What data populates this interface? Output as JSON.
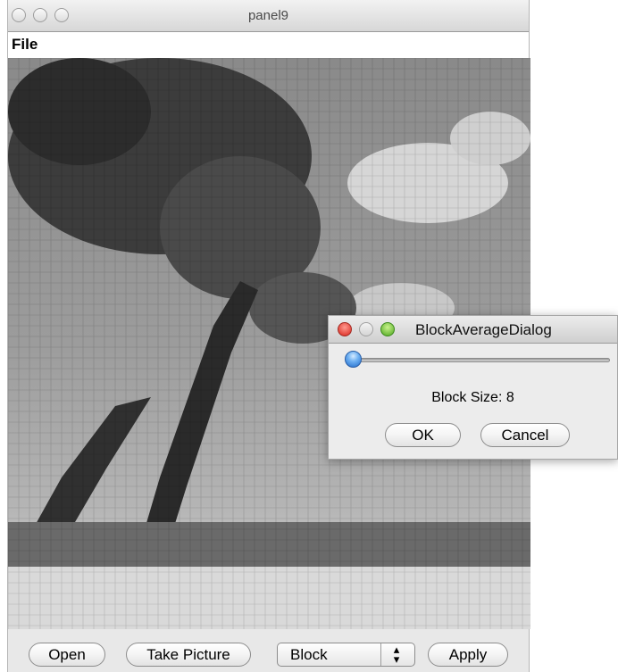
{
  "window": {
    "title": "panel9"
  },
  "menu": {
    "file": "File"
  },
  "toolbar": {
    "open_label": "Open",
    "take_picture_label": "Take Picture",
    "filter_select": "Block",
    "apply_label": "Apply"
  },
  "dialog": {
    "title": "BlockAverageDialog",
    "block_size_label": "Block Size: 8",
    "ok_label": "OK",
    "cancel_label": "Cancel",
    "slider_level": 0.0
  },
  "icons": {
    "close": "close-icon",
    "minimize": "minimize-icon",
    "zoom": "zoom-icon",
    "combo_arrows": "updown-arrows-icon"
  },
  "colors": {
    "close_red": "#d8231a",
    "zoom_green": "#4ca61e",
    "slider_blue": "#1f69c9"
  }
}
